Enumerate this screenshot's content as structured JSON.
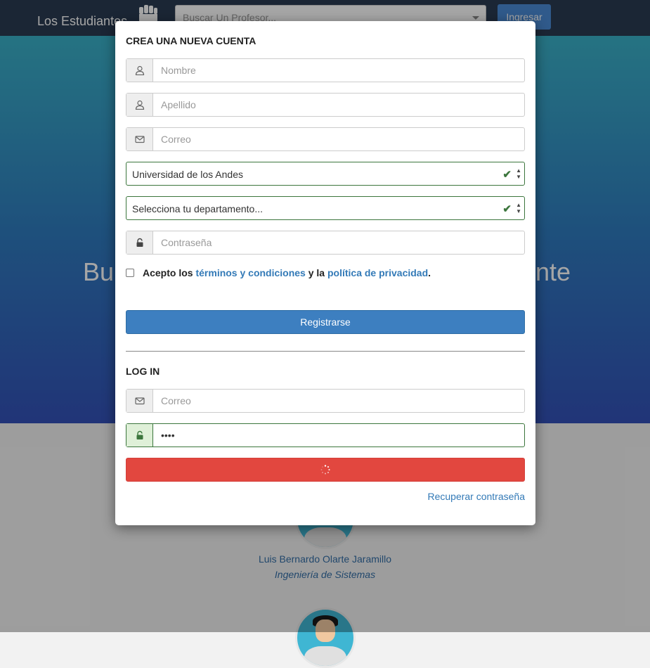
{
  "navbar": {
    "brand": "Los Estudiantes",
    "search_placeholder": "Buscar Un Profesor...",
    "login_button": "Ingresar"
  },
  "hero": {
    "title_left": "Bu",
    "title_right": "nte"
  },
  "professor": {
    "name": "Luis Bernardo Olarte Jaramillo",
    "department": "Ingeniería de Sistemas"
  },
  "register": {
    "title": "CREA UNA NUEVA CUENTA",
    "first_name_placeholder": "Nombre",
    "last_name_placeholder": "Apellido",
    "email_placeholder": "Correo",
    "university_value": "Universidad de los Andes",
    "department_value": "Selecciona tu departamento...",
    "password_placeholder": "Contraseña",
    "terms_prefix": "Acepto los",
    "terms_link": "términos y condiciones",
    "terms_middle": "y la",
    "privacy_link": "política de privacidad",
    "terms_suffix": ".",
    "submit": "Registrarse"
  },
  "login": {
    "title": "LOG IN",
    "email_placeholder": "Correo",
    "password_value": "••••",
    "recover_link": "Recuperar contraseña"
  },
  "colors": {
    "navbar": "#2a3b52",
    "primary": "#3d7fc0",
    "danger": "#e2473f",
    "success": "#3c763d",
    "link": "#337ab7"
  }
}
